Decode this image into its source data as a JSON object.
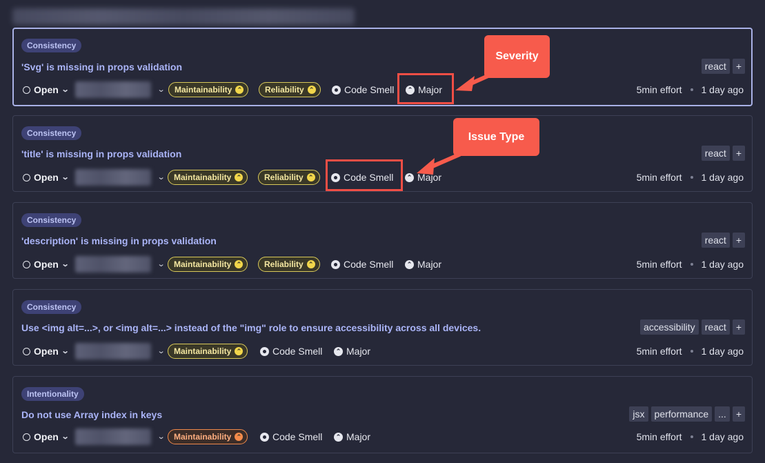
{
  "issues": [
    {
      "category": "Consistency",
      "title": "'Svg' is missing in props validation",
      "tags": [
        "react",
        "+"
      ],
      "status": "Open",
      "qualities": [
        {
          "label": "Maintainability",
          "icon": "⌃"
        },
        {
          "label": "Reliability",
          "icon": "⌃"
        }
      ],
      "type": "Code Smell",
      "severity": "Major",
      "effort": "5min effort",
      "age": "1 day ago"
    },
    {
      "category": "Consistency",
      "title": "'title' is missing in props validation",
      "tags": [
        "react",
        "+"
      ],
      "status": "Open",
      "qualities": [
        {
          "label": "Maintainability",
          "icon": "⌃"
        },
        {
          "label": "Reliability",
          "icon": "⌃"
        }
      ],
      "type": "Code Smell",
      "severity": "Major",
      "effort": "5min effort",
      "age": "1 day ago"
    },
    {
      "category": "Consistency",
      "title": "'description' is missing in props validation",
      "tags": [
        "react",
        "+"
      ],
      "status": "Open",
      "qualities": [
        {
          "label": "Maintainability",
          "icon": "⌃"
        },
        {
          "label": "Reliability",
          "icon": "⌃"
        }
      ],
      "type": "Code Smell",
      "severity": "Major",
      "effort": "5min effort",
      "age": "1 day ago"
    },
    {
      "category": "Consistency",
      "title": "Use <img alt=...>, or <img alt=...> instead of the \"img\" role to ensure accessibility across all devices.",
      "tags": [
        "accessibility",
        "react",
        "+"
      ],
      "status": "Open",
      "qualities": [
        {
          "label": "Maintainability",
          "icon": "⌃"
        }
      ],
      "type": "Code Smell",
      "severity": "Major",
      "effort": "5min effort",
      "age": "1 day ago"
    },
    {
      "category": "Intentionality",
      "title": "Do not use Array index in keys",
      "tags": [
        "jsx",
        "performance",
        "...",
        "+"
      ],
      "status": "Open",
      "qualities": [
        {
          "label": "Maintainability",
          "icon": "⌃"
        }
      ],
      "type": "Code Smell",
      "severity": "Major",
      "effort": "5min effort",
      "age": "1 day ago"
    }
  ],
  "annotations": {
    "severity": "Severity",
    "issue_type": "Issue Type"
  },
  "colors": {
    "accent": "#aab4f7",
    "highlight": "#f04e45",
    "callout": "#f75b4c",
    "medium": "#f2d64b",
    "high": "#f58b4b"
  }
}
